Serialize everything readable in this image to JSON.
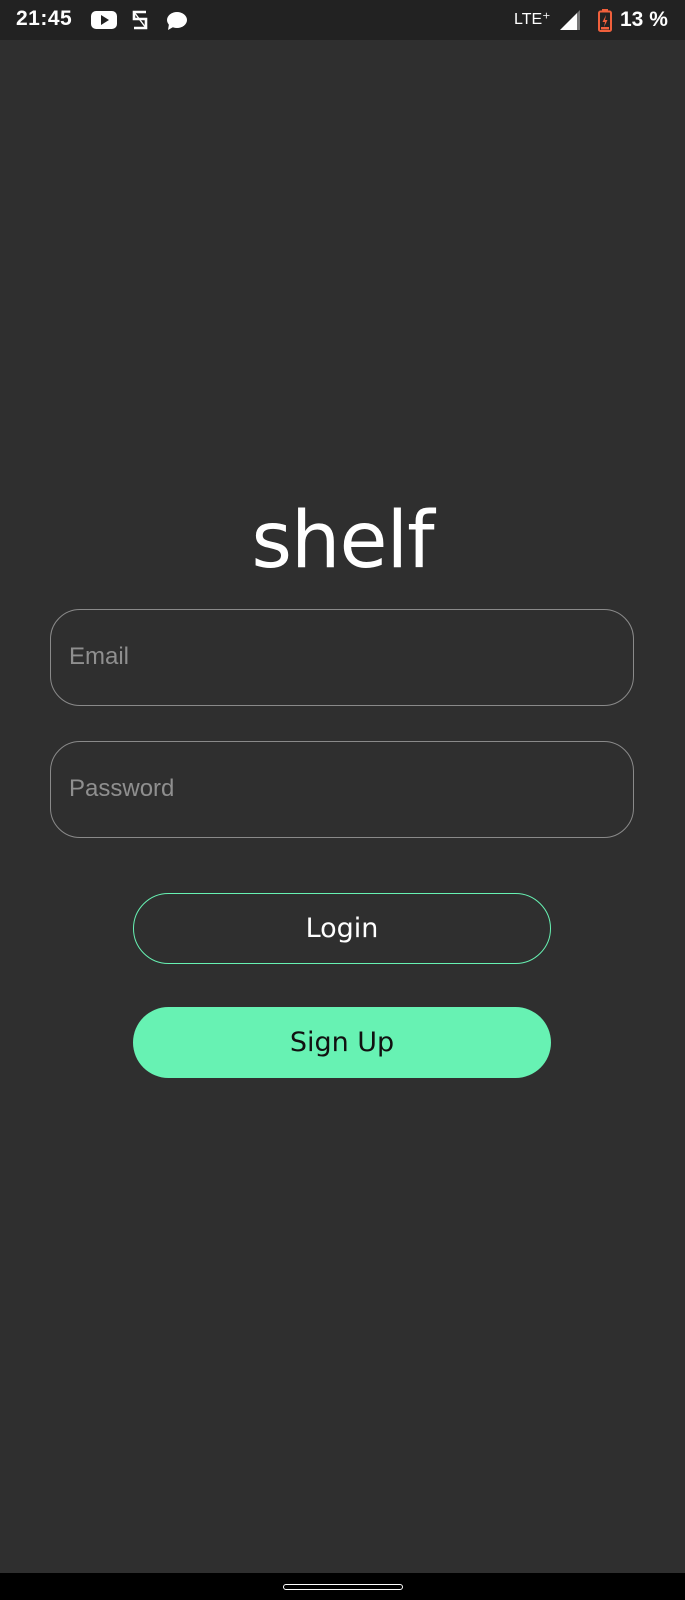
{
  "status_bar": {
    "time": "21:45",
    "notification_icons": [
      "youtube-icon",
      "s-app-icon",
      "message-bubble-icon"
    ],
    "network": "LTE⁺",
    "signal_icon": "signal-strength-icon",
    "battery_icon": "battery-charging-icon",
    "battery_level": "13 %",
    "battery_fraction": 0.13
  },
  "app": {
    "logo_text": "shelf"
  },
  "login_form": {
    "email_placeholder": "Email",
    "password_placeholder": "Password",
    "login_label": "Login",
    "signup_label": "Sign Up"
  },
  "colors": {
    "background": "#2f2f2f",
    "status_bar": "#222222",
    "accent": "#67f2b3",
    "field_border": "#8a8a8a",
    "placeholder": "#8f8f8f",
    "battery_icon": "#f0603c"
  },
  "nav_bar": {
    "handle_icon": "gesture-handle"
  }
}
